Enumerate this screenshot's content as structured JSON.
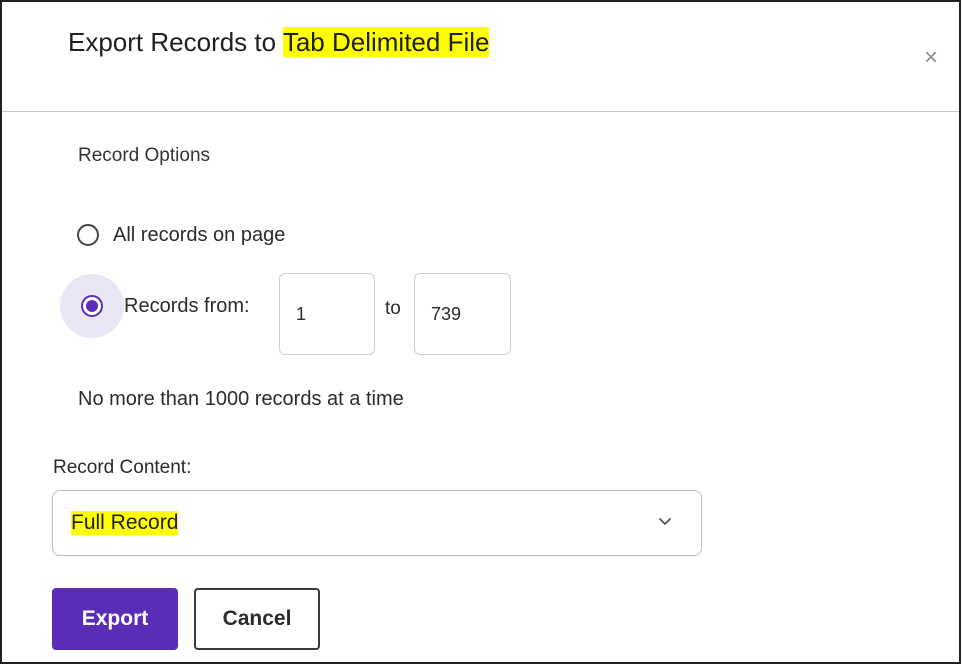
{
  "dialog": {
    "title_prefix": "Export Records to ",
    "title_highlight": "Tab Delimited File",
    "close_glyph": "×"
  },
  "record_options": {
    "section_label": "Record Options",
    "all_records_label": "All records on page",
    "records_from_label": "Records from:",
    "from_value": "1",
    "to_label": "to",
    "to_value": "739",
    "selected_option": "records_from",
    "limit_note": "No more than 1000 records at a time"
  },
  "record_content": {
    "label": "Record Content:",
    "selected_value": "Full Record"
  },
  "actions": {
    "export_label": "Export",
    "cancel_label": "Cancel"
  },
  "colors": {
    "accent": "#5a2db7",
    "highlight": "#ffff00",
    "radio_focus_halo": "#ebe6f5"
  },
  "icons": {
    "close": "close-icon",
    "dropdown": "chevron-down-icon"
  }
}
